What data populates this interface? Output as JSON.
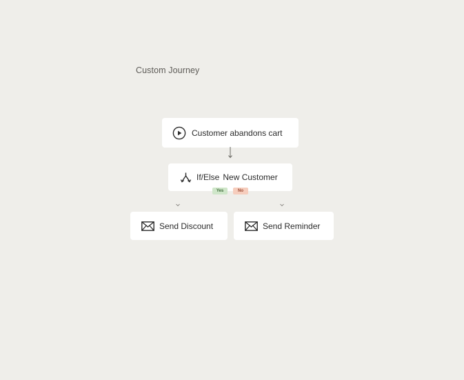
{
  "journey": {
    "title": "Custom Journey"
  },
  "nodes": {
    "trigger": {
      "label": "Customer abandons cart",
      "icon": "play-circle-icon"
    },
    "condition": {
      "keyword": "If/Else",
      "label": "New Customer",
      "icon": "split-branch-icon",
      "branches": {
        "yes": "Yes",
        "no": "No"
      }
    },
    "actions": [
      {
        "label": "Send Discount",
        "icon": "envelope-icon"
      },
      {
        "label": "Send Reminder",
        "icon": "envelope-icon"
      }
    ]
  },
  "colors": {
    "background": "#efeeea",
    "node": "#ffffff",
    "yes_badge": "#cfe6c9",
    "no_badge": "#f6cdbd"
  }
}
